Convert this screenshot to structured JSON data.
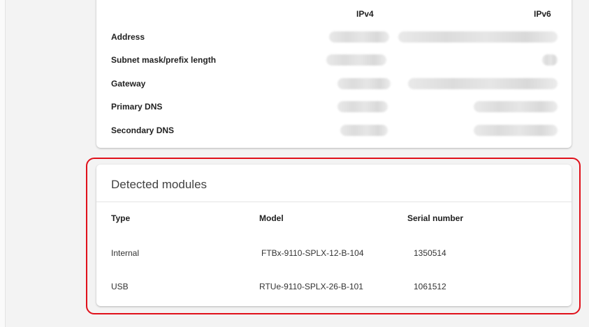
{
  "network": {
    "columns": {
      "ipv4": "IPv4",
      "ipv6": "IPv6"
    },
    "rows": [
      {
        "label": "Address"
      },
      {
        "label": "Subnet mask/prefix length"
      },
      {
        "label": "Gateway"
      },
      {
        "label": "Primary DNS"
      },
      {
        "label": "Secondary DNS"
      }
    ]
  },
  "modules": {
    "title": "Detected modules",
    "columns": {
      "type": "Type",
      "model": "Model",
      "serial": "Serial number"
    },
    "rows": [
      {
        "type": "Internal",
        "model": "FTBx-9110-SPLX-12-B-104",
        "serial": "1350514"
      },
      {
        "type": "USB",
        "model": "RTUe-9110-SPLX-26-B-101",
        "serial": "1061512"
      }
    ]
  },
  "colors": {
    "highlight": "#e0101a",
    "background": "#f3f3f3",
    "card": "#ffffff"
  }
}
